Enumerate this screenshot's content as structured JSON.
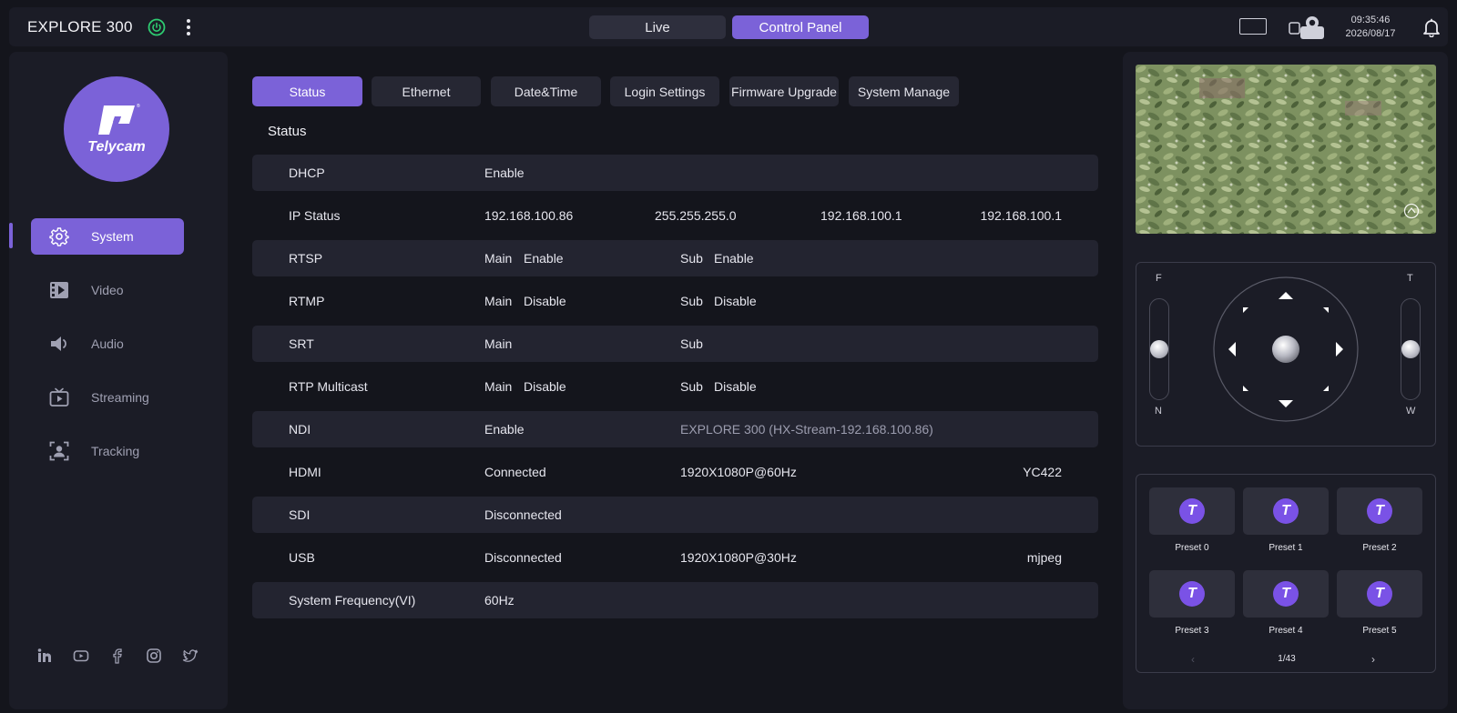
{
  "header": {
    "device_name": "EXPLORE 300",
    "tabs": [
      {
        "label": "Live",
        "active": false
      },
      {
        "label": "Control Panel",
        "active": true
      }
    ],
    "time": "09:35:46",
    "date": "2026/08/17"
  },
  "colors": {
    "accent": "#7b62d8",
    "power": "#2ecc71",
    "panel_bg": "#1b1c26",
    "page_bg": "#14151c"
  },
  "sidebar": {
    "logo_text": "Telycam",
    "items": [
      {
        "label": "System",
        "icon": "gear-icon",
        "active": true
      },
      {
        "label": "Video",
        "icon": "video-icon",
        "active": false
      },
      {
        "label": "Audio",
        "icon": "speaker-icon",
        "active": false
      },
      {
        "label": "Streaming",
        "icon": "tv-icon",
        "active": false
      },
      {
        "label": "Tracking",
        "icon": "tracking-icon",
        "active": false
      }
    ],
    "socials": [
      "linkedin-icon",
      "youtube-icon",
      "facebook-icon",
      "instagram-icon",
      "twitter-icon"
    ]
  },
  "subtabs": [
    {
      "label": "Status",
      "active": true
    },
    {
      "label": "Ethernet",
      "active": false
    },
    {
      "label": "Date&Time",
      "active": false
    },
    {
      "label": "Login Settings",
      "active": false
    },
    {
      "label": "Firmware Upgrade",
      "active": false
    },
    {
      "label": "System Manage",
      "active": false
    }
  ],
  "status": {
    "title": "Status",
    "dhcp": {
      "label": "DHCP",
      "value": "Enable"
    },
    "ip_status": {
      "label": "IP Status",
      "ip": "192.168.100.86",
      "mask": "255.255.255.0",
      "gateway": "192.168.100.1",
      "dns": "192.168.100.1"
    },
    "rtsp": {
      "label": "RTSP",
      "main": "Main",
      "main_state": "Enable",
      "sub": "Sub",
      "sub_state": "Enable"
    },
    "rtmp": {
      "label": "RTMP",
      "main": "Main",
      "main_state": "Disable",
      "sub": "Sub",
      "sub_state": "Disable"
    },
    "srt": {
      "label": "SRT",
      "main": "Main",
      "sub": "Sub"
    },
    "rtp_multicast": {
      "label": "RTP Multicast",
      "main": "Main",
      "main_state": "Disable",
      "sub": "Sub",
      "sub_state": "Disable"
    },
    "ndi": {
      "label": "NDI",
      "value": "Enable",
      "name": "EXPLORE 300 (HX-Stream-192.168.100.86)"
    },
    "hdmi": {
      "label": "HDMI",
      "value": "Connected",
      "format": "1920X1080P@60Hz",
      "color": "YC422"
    },
    "sdi": {
      "label": "SDI",
      "value": "Disconnected"
    },
    "usb": {
      "label": "USB",
      "value": "Disconnected",
      "format": "1920X1080P@30Hz",
      "codec": "mjpeg"
    },
    "sys_freq": {
      "label": "System Frequency(VI)",
      "value": "60Hz"
    }
  },
  "ptz": {
    "focus_far": "F",
    "focus_near": "N",
    "zoom_tele": "T",
    "zoom_wide": "W",
    "focus_level": 0.5,
    "zoom_level": 0.5
  },
  "presets": {
    "items": [
      {
        "label": "Preset 0"
      },
      {
        "label": "Preset 1"
      },
      {
        "label": "Preset 2"
      },
      {
        "label": "Preset 3"
      },
      {
        "label": "Preset 4"
      },
      {
        "label": "Preset 5"
      }
    ],
    "logo_letter": "T",
    "pager": "1/43",
    "prev": "‹",
    "next": "›"
  }
}
